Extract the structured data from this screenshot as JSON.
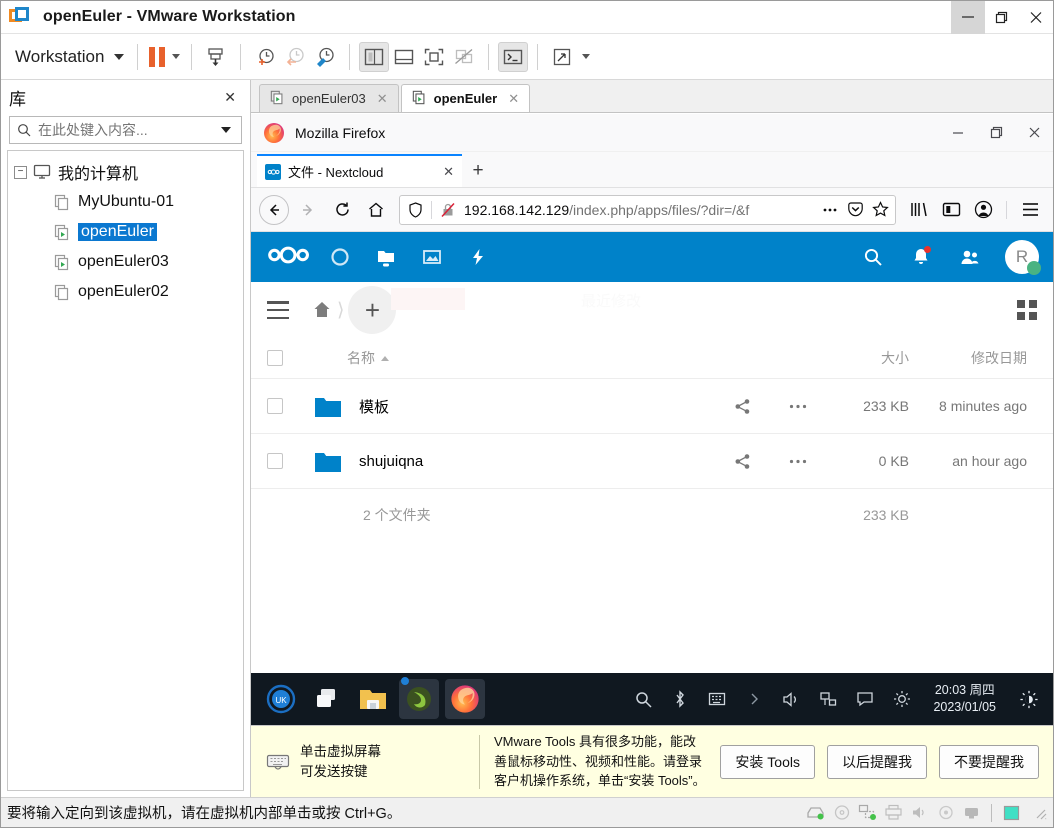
{
  "window": {
    "title": "openEuler - VMware Workstation",
    "app_icon": "vmware-icon",
    "minimize": "minimize-icon",
    "maximize": "restore-icon",
    "close": "close-icon"
  },
  "toolbar": {
    "menu_label": "Workstation",
    "items": [
      {
        "name": "pause-vm",
        "icon": "pause-icon"
      },
      {
        "name": "send-ctrl-alt-del",
        "icon": "send-keys-icon"
      },
      {
        "name": "take-snapshot",
        "icon": "snapshot-add-icon"
      },
      {
        "name": "revert-snapshot",
        "icon": "snapshot-revert-icon"
      },
      {
        "name": "manage-snapshots",
        "icon": "snapshot-manage-icon"
      },
      {
        "name": "show-library",
        "icon": "sidebar-panel-icon"
      },
      {
        "name": "show-thumbnail-bar",
        "icon": "thumbnail-bar-icon"
      },
      {
        "name": "fullscreen",
        "icon": "fullscreen-icon"
      },
      {
        "name": "unity-mode",
        "icon": "unity-mode-icon"
      },
      {
        "name": "console-view",
        "icon": "console-icon"
      },
      {
        "name": "stretch-view",
        "icon": "stretch-icon"
      }
    ]
  },
  "library": {
    "title": "库",
    "close_label": "✕",
    "search": {
      "placeholder": "在此处键入内容...",
      "value": "",
      "icon": "search-icon"
    },
    "tree": {
      "root": {
        "label": "我的计算机",
        "icon": "computer-icon",
        "expander": "−"
      },
      "items": [
        {
          "label": "MyUbuntu-01",
          "icon": "vm-powered-off-icon",
          "selected": false
        },
        {
          "label": "openEuler",
          "icon": "vm-running-icon",
          "selected": true
        },
        {
          "label": "openEuler03",
          "icon": "vm-running-icon",
          "selected": false
        },
        {
          "label": "openEuler02",
          "icon": "vm-powered-off-icon",
          "selected": false
        }
      ]
    }
  },
  "vm_tabs": [
    {
      "label": "openEuler03",
      "active": false,
      "icon": "vm-running-icon",
      "close": "✕"
    },
    {
      "label": "openEuler",
      "active": true,
      "icon": "vm-running-icon",
      "close": "✕"
    }
  ],
  "guest": {
    "firefox": {
      "title": "Mozilla Firefox",
      "logo": "firefox-logo-icon",
      "window_controls": {
        "minimize": "−",
        "maximize": "restore-icon",
        "close": "✕"
      },
      "tab": {
        "title": "文件 - Nextcloud",
        "favicon": "nextcloud-favicon",
        "close": "✕"
      },
      "new_tab": "+",
      "nav": {
        "back": "back-arrow-icon",
        "forward": "forward-arrow-icon",
        "reload": "reload-icon",
        "home": "home-icon"
      },
      "url": {
        "host": "192.168.142.129",
        "path": "/index.php/apps/files/?dir=/&f",
        "shield_icon": "shield-icon",
        "insecure_icon": "insecure-lock-icon",
        "page_actions_icon": "ellipsis-icon",
        "pocket_icon": "pocket-icon",
        "bookmark_icon": "star-icon"
      },
      "toolbar_right": {
        "library": "library-icon",
        "sidebar": "sidebar-icon",
        "account": "account-icon",
        "menu": "hamburger-menu-icon"
      }
    },
    "nextcloud": {
      "header": {
        "logo": "nextcloud-logo",
        "nav": [
          {
            "name": "dashboard",
            "icon": "dashboard-circle-icon"
          },
          {
            "name": "files",
            "icon": "folder-icon"
          },
          {
            "name": "photos",
            "icon": "photos-icon"
          },
          {
            "name": "activity",
            "icon": "activity-bolt-icon"
          }
        ],
        "search_icon": "search-icon",
        "notifications_icon": "bell-icon",
        "notifications_badge": true,
        "contacts_icon": "contacts-icon",
        "avatar_letter": "R",
        "avatar_status": "online"
      },
      "controls": {
        "menu_icon": "hamburger-icon",
        "home_icon": "home-breadcrumb-icon",
        "new_label": "+",
        "grid_icon": "grid-view-icon",
        "ghost_text": "最近修改"
      },
      "table": {
        "headers": {
          "name": "名称",
          "size": "大小",
          "modified": "修改日期"
        },
        "sort": "asc",
        "rows": [
          {
            "name": "模板",
            "icon": "folder-icon",
            "share_icon": "share-icon",
            "more_icon": "ellipsis-icon",
            "size": "233 KB",
            "modified": "8 minutes ago"
          },
          {
            "name": "shujuiqna",
            "icon": "folder-icon",
            "share_icon": "share-icon",
            "more_icon": "ellipsis-icon",
            "size": "0 KB",
            "modified": "an hour ago"
          }
        ],
        "footer": {
          "label": "2 个文件夹",
          "size": "233 KB"
        }
      }
    },
    "taskbar": {
      "launchers": [
        {
          "name": "start-menu",
          "icon": "openeuler-logo-icon"
        },
        {
          "name": "show-desktop",
          "icon": "windows-switch-icon"
        },
        {
          "name": "file-manager",
          "icon": "file-manager-icon"
        },
        {
          "name": "terminal",
          "icon": "terminal-icon"
        },
        {
          "name": "firefox",
          "icon": "firefox-logo-icon"
        }
      ],
      "tray": [
        {
          "name": "search",
          "icon": "search-icon"
        },
        {
          "name": "bluetooth",
          "icon": "bluetooth-icon"
        },
        {
          "name": "input-method",
          "icon": "keyboard-icon"
        },
        {
          "name": "tray-expand",
          "icon": "chevron-right-icon"
        },
        {
          "name": "volume",
          "icon": "volume-icon"
        },
        {
          "name": "network",
          "icon": "network-icon"
        },
        {
          "name": "messages",
          "icon": "message-icon"
        },
        {
          "name": "brightness",
          "icon": "brightness-icon"
        }
      ],
      "clock": {
        "time": "20:03 周四",
        "date": "2023/01/05"
      },
      "night_mode_icon": "night-mode-icon"
    }
  },
  "vmware_tools_notice": {
    "keyboard_icon": "keyboard-icon",
    "hint_line1": "单击虚拟屏幕",
    "hint_line2": "可发送按键",
    "message": "VMware Tools 具有很多功能，能改善鼠标移动性、视频和性能。请登录客户机操作系统，单击“安装 Tools”。",
    "buttons": [
      {
        "label": "安装 Tools",
        "name": "install-tools-button"
      },
      {
        "label": "以后提醒我",
        "name": "remind-later-button"
      },
      {
        "label": "不要提醒我",
        "name": "never-remind-button"
      }
    ]
  },
  "statusbar": {
    "message": "要将输入定向到该虚拟机，请在虚拟机内部单击或按 Ctrl+G。",
    "devices": [
      {
        "name": "hard-disk",
        "icon": "harddisk-icon",
        "active": true
      },
      {
        "name": "cd-dvd",
        "icon": "cd-icon",
        "active": false
      },
      {
        "name": "network-adapter",
        "icon": "network-icon",
        "active": true
      },
      {
        "name": "printer",
        "icon": "printer-icon",
        "active": false
      },
      {
        "name": "sound-card",
        "icon": "sound-icon",
        "active": false
      },
      {
        "name": "usb-device",
        "icon": "usb-icon",
        "active": false
      },
      {
        "name": "display",
        "icon": "display-icon",
        "active": false
      }
    ]
  },
  "colors": {
    "nextcloud_blue": "#0082c9",
    "selection_blue": "#0b78d0",
    "vmware_orange": "#e8612c",
    "firefox_tab_accent": "#0a84ff",
    "notice_yellow": "#ffffe1"
  }
}
